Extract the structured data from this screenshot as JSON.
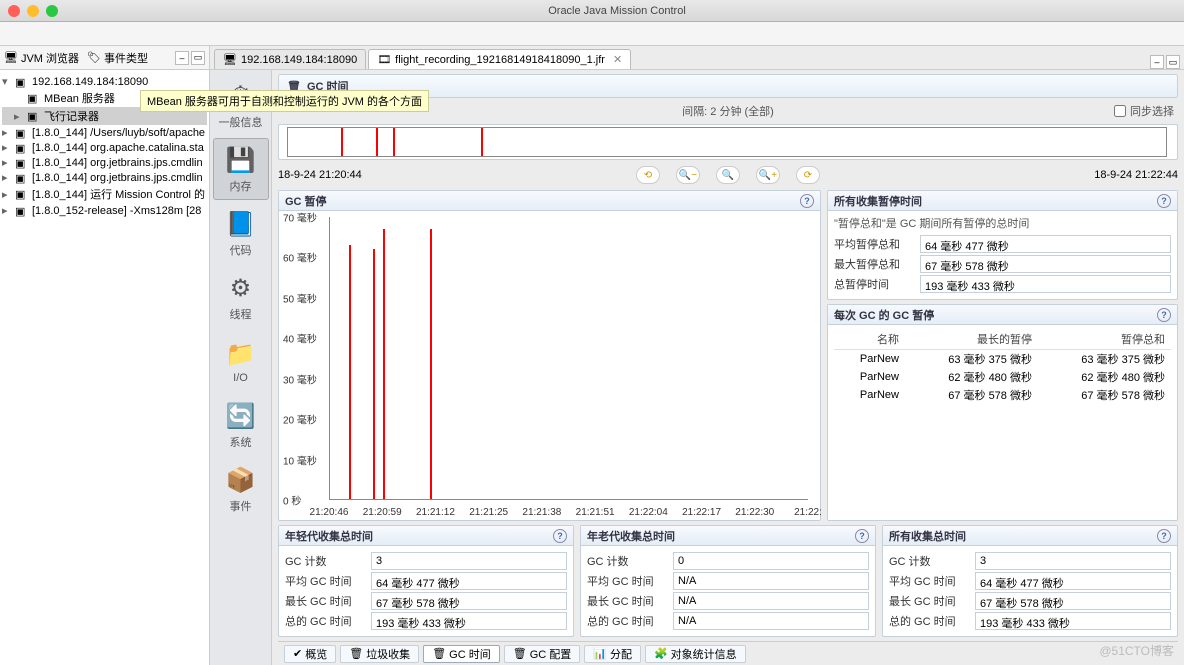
{
  "window": {
    "title": "Oracle Java Mission Control"
  },
  "sidebar": {
    "tabs": [
      {
        "icon": "jvm-icon",
        "label": "JVM 浏览器"
      },
      {
        "icon": "tag-icon",
        "label": "事件类型"
      }
    ],
    "tree": [
      {
        "lvl": 0,
        "arrow": "▾",
        "label": "192.168.149.184:18090"
      },
      {
        "lvl": 1,
        "arrow": "",
        "label": "MBean 服务器"
      },
      {
        "lvl": 1,
        "arrow": "▸",
        "label": "飞行记录器",
        "sel": true
      },
      {
        "lvl": 0,
        "arrow": "▸",
        "label": "[1.8.0_144] /Users/luyb/soft/apache"
      },
      {
        "lvl": 0,
        "arrow": "▸",
        "label": "[1.8.0_144] org.apache.catalina.sta"
      },
      {
        "lvl": 0,
        "arrow": "▸",
        "label": "[1.8.0_144] org.jetbrains.jps.cmdlin"
      },
      {
        "lvl": 0,
        "arrow": "▸",
        "label": "[1.8.0_144] org.jetbrains.jps.cmdlin"
      },
      {
        "lvl": 0,
        "arrow": "▸",
        "label": "[1.8.0_144] 运行 Mission Control 的"
      },
      {
        "lvl": 0,
        "arrow": "▸",
        "label": "[1.8.0_152-release] -Xms128m [28"
      }
    ]
  },
  "tooltip": "MBean 服务器可用于自测和控制运行的 JVM 的各个方面",
  "editor_tabs": [
    {
      "label": "192.168.149.184:18090",
      "active": false
    },
    {
      "label": "flight_recording_19216814918418090_1.jfr",
      "active": true
    }
  ],
  "nav": [
    {
      "label": "一般信息"
    },
    {
      "label": "内存",
      "sel": true
    },
    {
      "label": "代码"
    },
    {
      "label": "线程"
    },
    {
      "label": "I/O"
    },
    {
      "label": "系统"
    },
    {
      "label": "事件"
    }
  ],
  "page": {
    "title": "GC 时间",
    "interval": "间隔: 2 分钟 (全部)",
    "sync": "同步选择",
    "t_start": "18-9-24 21:20:44",
    "t_end": "18-9-24 21:22:44"
  },
  "chart_data": {
    "type": "bar",
    "title": "GC 暂停",
    "ylabel": "毫秒",
    "ylim": [
      0,
      70
    ],
    "yticks": [
      0,
      10,
      20,
      30,
      40,
      50,
      60,
      70
    ],
    "xticks": [
      "21:20:46",
      "21:20:59",
      "21:21:12",
      "21:21:25",
      "21:21:38",
      "21:21:51",
      "21:22:04",
      "21:22:17",
      "21:22:30",
      "21:22:"
    ],
    "series": [
      {
        "name": "ParNew",
        "x": "21:20:49",
        "value": 63
      },
      {
        "name": "ParNew",
        "x": "21:20:54",
        "value": 62
      },
      {
        "name": "ParNew",
        "x": "21:20:55",
        "value": 67
      },
      {
        "name": "ParNew",
        "x": "21:21:06",
        "value": 67
      }
    ]
  },
  "summary": {
    "title": "所有收集暂停时间",
    "subtitle": "\"暂停总和\"是 GC 期间所有暂停的总时间",
    "rows": [
      {
        "k": "平均暂停总和",
        "v": "64 毫秒 477 微秒"
      },
      {
        "k": "最大暂停总和",
        "v": "67 毫秒 578 微秒"
      },
      {
        "k": "总暂停时间",
        "v": "193 毫秒 433 微秒"
      }
    ]
  },
  "per_gc": {
    "title": "每次 GC 的 GC 暂停",
    "cols": [
      "名称",
      "最长的暂停",
      "暂停总和"
    ],
    "rows": [
      [
        "ParNew",
        "63 毫秒 375 微秒",
        "63 毫秒 375 微秒"
      ],
      [
        "ParNew",
        "62 毫秒 480 微秒",
        "62 毫秒 480 微秒"
      ],
      [
        "ParNew",
        "67 毫秒 578 微秒",
        "67 毫秒 578 微秒"
      ]
    ]
  },
  "triple": [
    {
      "title": "年轻代收集总时间",
      "rows": [
        {
          "k": "GC 计数",
          "v": "3"
        },
        {
          "k": "平均 GC 时间",
          "v": "64 毫秒 477 微秒"
        },
        {
          "k": "最长 GC 时间",
          "v": "67 毫秒 578 微秒"
        },
        {
          "k": "总的 GC 时间",
          "v": "193 毫秒 433 微秒"
        }
      ]
    },
    {
      "title": "年老代收集总时间",
      "rows": [
        {
          "k": "GC 计数",
          "v": "0"
        },
        {
          "k": "平均 GC 时间",
          "v": "N/A"
        },
        {
          "k": "最长 GC 时间",
          "v": "N/A"
        },
        {
          "k": "总的 GC 时间",
          "v": "N/A"
        }
      ]
    },
    {
      "title": "所有收集总时间",
      "rows": [
        {
          "k": "GC 计数",
          "v": "3"
        },
        {
          "k": "平均 GC 时间",
          "v": "64 毫秒 477 微秒"
        },
        {
          "k": "最长 GC 时间",
          "v": "67 毫秒 578 微秒"
        },
        {
          "k": "总的 GC 时间",
          "v": "193 毫秒 433 微秒"
        }
      ]
    }
  ],
  "bottom_tabs": [
    {
      "label": "概览"
    },
    {
      "label": "垃圾收集"
    },
    {
      "label": "GC 时间",
      "active": true
    },
    {
      "label": "GC 配置"
    },
    {
      "label": "分配"
    },
    {
      "label": "对象统计信息"
    }
  ],
  "watermark": "@51CTO博客"
}
